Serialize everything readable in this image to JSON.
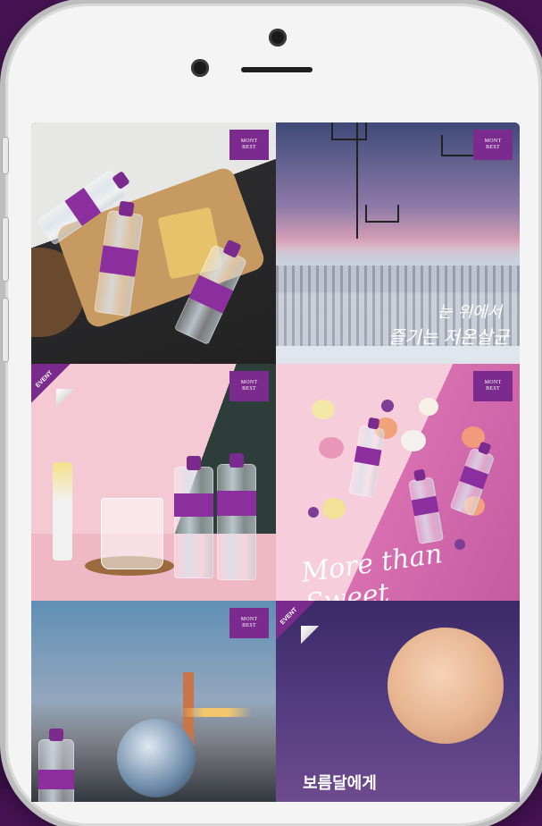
{
  "device": "phone-mockup",
  "colors": {
    "background": "#4a1458",
    "brand_purple": "#7b2a8d",
    "phone_body": "#f4f4f4"
  },
  "gallery": {
    "tiles": [
      {
        "id": "tile-1",
        "badge": [
          "MONT",
          "BEST"
        ],
        "event": ""
      },
      {
        "id": "tile-2",
        "badge": [
          "MONT",
          "BEST"
        ],
        "event": "",
        "caption_line1": "눈 위에서",
        "caption_line2": "즐기는 저온살균"
      },
      {
        "id": "tile-3",
        "badge": [
          "MONT",
          "BEST"
        ],
        "event": "EVENT"
      },
      {
        "id": "tile-4",
        "badge": [
          "MONT",
          "BEST"
        ],
        "event": "",
        "script": "More than Sweet"
      },
      {
        "id": "tile-5",
        "badge": [
          "MONT",
          "BEST"
        ],
        "event": ""
      },
      {
        "id": "tile-6",
        "badge": [],
        "event": "EVENT",
        "caption": "보름달에게"
      }
    ]
  }
}
